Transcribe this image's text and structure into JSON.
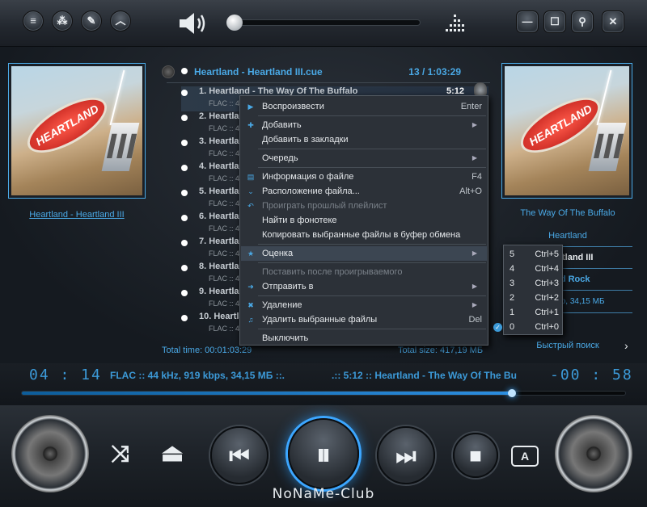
{
  "toolbar": {
    "buttons": [
      {
        "name": "menu-icon",
        "glyph": "≡"
      },
      {
        "name": "nodes-icon",
        "glyph": "⁂"
      },
      {
        "name": "wrench-icon",
        "glyph": "✎"
      },
      {
        "name": "chevron-up-icon",
        "glyph": "︿"
      }
    ],
    "window_buttons": [
      {
        "name": "minimize-icon",
        "glyph": "—"
      },
      {
        "name": "maximize-icon",
        "glyph": "☐"
      },
      {
        "name": "pin-icon",
        "glyph": "⚲"
      },
      {
        "name": "close-icon",
        "glyph": "✕"
      }
    ],
    "volume": 0.04
  },
  "left_panel": {
    "album_link": "Heartland - Heartland III"
  },
  "playlist": {
    "name": "Heartland - Heartland III.cue",
    "summary": "13 / 1:03:29",
    "tracks": [
      {
        "title": "1. Heartland - The Way Of The Buffalo",
        "sub": "FLAC :: 4",
        "dur": "5:12"
      },
      {
        "title": "2. Heartland - A",
        "sub": "FLAC :: 4",
        "dur": ""
      },
      {
        "title": "3. Heartland - A",
        "sub": "FLAC :: 4",
        "dur": ""
      },
      {
        "title": "4. Heartland - A",
        "sub": "FLAC :: 4",
        "dur": ""
      },
      {
        "title": "5. Heartland - A",
        "sub": "FLAC :: 4",
        "dur": ""
      },
      {
        "title": "6. Heartland - A",
        "sub": "FLAC :: 4",
        "dur": ""
      },
      {
        "title": "7. Heartland - A",
        "sub": "FLAC :: 4",
        "dur": ""
      },
      {
        "title": "8. Heartland - A",
        "sub": "FLAC :: 4",
        "dur": ""
      },
      {
        "title": "9. Heartland - A",
        "sub": "FLAC :: 4",
        "dur": ""
      },
      {
        "title": "10. Heartland - A",
        "sub": "FLAC :: 4",
        "dur": ""
      }
    ],
    "total_time": "Total time: 00:01:03:29",
    "total_size": "Total size: 417,19 МБ"
  },
  "right_panel": {
    "track": "The Way Of The Buffalo",
    "artist": "Heartland",
    "album": "Heartland III",
    "genre": "Hard Rock",
    "format": "ts, Stereo, 34,15 МБ",
    "quick_search": "Быстрый поиск",
    "quick_search_arrow": "›"
  },
  "context_menu": {
    "items": [
      {
        "icon": "▶",
        "label": "Воспроизвести",
        "shortcut": "Enter"
      },
      {
        "sep": true
      },
      {
        "icon": "✚",
        "label": "Добавить",
        "submenu": true
      },
      {
        "icon": "",
        "label": "Добавить в закладки"
      },
      {
        "sep": true
      },
      {
        "icon": "",
        "label": "Очередь",
        "submenu": true
      },
      {
        "sep": true
      },
      {
        "icon": "▤",
        "label": "Информация о файле",
        "shortcut": "F4"
      },
      {
        "icon": "⌄",
        "label": "Расположение файла...",
        "shortcut": "Alt+O"
      },
      {
        "icon": "↶",
        "label": "Проиграть прошлый плейлист",
        "disabled": true
      },
      {
        "icon": "",
        "label": "Найти в фонотеке"
      },
      {
        "icon": "",
        "label": "Копировать выбранные файлы в буфер обмена"
      },
      {
        "sep": true
      },
      {
        "icon": "★",
        "label": "Оценка",
        "submenu": true,
        "highlight": true
      },
      {
        "sep": true
      },
      {
        "icon": "",
        "label": "Поставить после проигрываемого",
        "disabled": true
      },
      {
        "icon": "➜",
        "label": "Отправить в",
        "submenu": true
      },
      {
        "sep": true
      },
      {
        "icon": "✖",
        "label": "Удаление",
        "submenu": true
      },
      {
        "icon": "♫",
        "label": "Удалить выбранные файлы",
        "shortcut": "Del"
      },
      {
        "sep": true
      },
      {
        "icon": "",
        "label": "Выключить"
      }
    ]
  },
  "rating_submenu": [
    {
      "num": "5",
      "key": "Ctrl+5"
    },
    {
      "num": "4",
      "key": "Ctrl+4"
    },
    {
      "num": "3",
      "key": "Ctrl+3"
    },
    {
      "num": "2",
      "key": "Ctrl+2"
    },
    {
      "num": "1",
      "key": "Ctrl+1"
    },
    {
      "num": "0",
      "key": "Ctrl+0",
      "checked": true
    }
  ],
  "status": {
    "elapsed": "04 : 14",
    "info": "FLAC :: 44 kHz, 919 kbps, 34,15 МБ ::.",
    "marquee": ".:: 5:12 :: Heartland - The Way Of The Bu",
    "remaining": "-00 : 58",
    "progress": 0.81
  },
  "controls": {
    "shuffle": "⤨",
    "eject": "⏏",
    "prev": "⏮",
    "pause": "⏸",
    "next": "⏭",
    "stop": "■",
    "repeat": "A"
  },
  "brand": "NoNaMe-Club",
  "colors": {
    "accent": "#3c9ad8",
    "link": "#4aa9e6"
  }
}
